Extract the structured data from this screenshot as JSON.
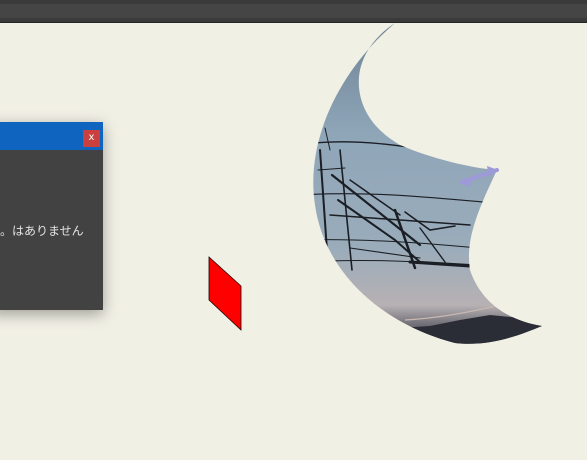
{
  "dialog": {
    "close_label": "x",
    "message": "はありません。"
  },
  "colors": {
    "background": "#f1f0e5",
    "titlebar": "#0f64c0",
    "dialog_body": "#424242",
    "close_button": "#c9403f",
    "shape_fill": "#ff0000"
  },
  "icons": {
    "close": "close-icon"
  }
}
